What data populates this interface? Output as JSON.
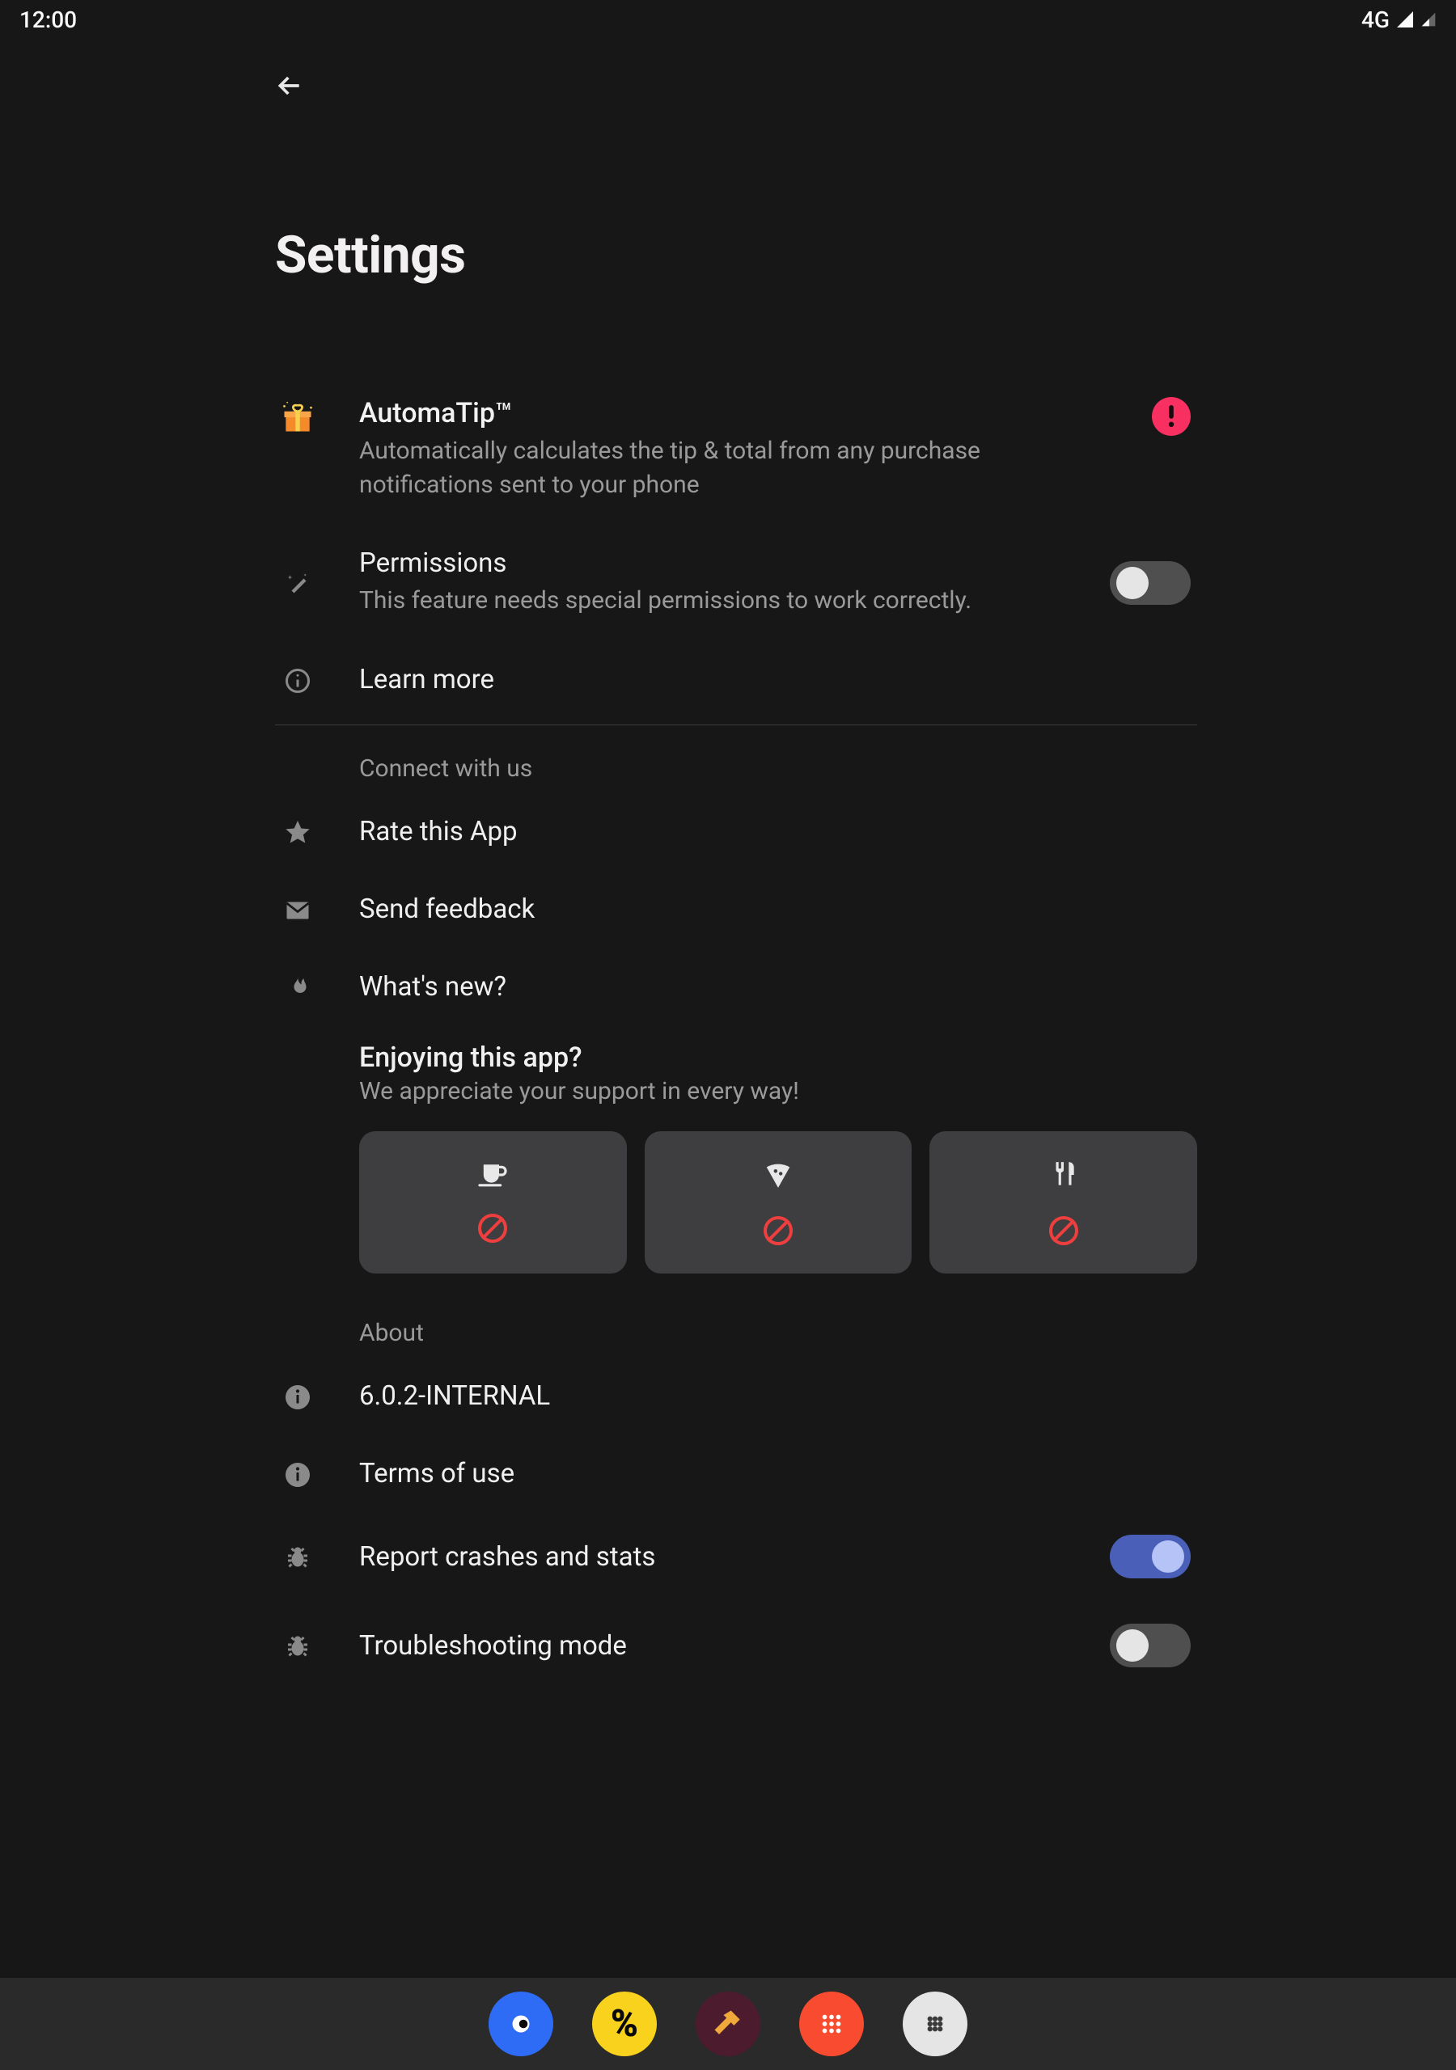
{
  "status": {
    "time": "12:00",
    "network": "4G"
  },
  "title": "Settings",
  "automatip": {
    "title": "AutomaTip™",
    "description": "Automatically calculates the tip & total from any purchase notifications sent to your phone",
    "permissions_title": "Permissions",
    "permissions_sub": "This feature needs special permissions to work correctly.",
    "permissions_on": false,
    "learn_more": "Learn more"
  },
  "connect": {
    "header": "Connect with us",
    "rate": "Rate this App",
    "feedback": "Send feedback",
    "whatsnew": "What's new?"
  },
  "support": {
    "title": "Enjoying this app?",
    "sub": "We appreciate your support in every way!"
  },
  "about": {
    "header": "About",
    "version": "6.0.2-INTERNAL",
    "terms": "Terms of use",
    "report": "Report crashes and stats",
    "report_on": true,
    "troubleshoot": "Troubleshooting mode",
    "troubleshoot_on": false
  }
}
